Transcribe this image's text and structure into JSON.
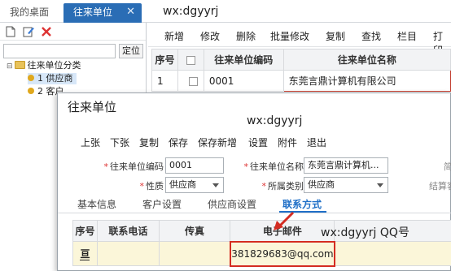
{
  "tabs": {
    "home": "我的桌面",
    "active": "往来单位",
    "close": "✕"
  },
  "watermark": "wx:dgyyrj",
  "left_panel": {
    "search_button": "定位",
    "tree": {
      "root": "往来单位分类",
      "items": [
        "1 供应商",
        "2 客户"
      ]
    }
  },
  "list": {
    "toolbar": [
      "新增",
      "修改",
      "删除",
      "批量修改",
      "复制",
      "查找",
      "栏目",
      "打印"
    ],
    "columns": [
      "序号",
      "",
      "往来单位编码",
      "往来单位名称"
    ],
    "rows": [
      {
        "seq": "1",
        "code": "0001",
        "name": "东莞言鼎计算机有限公司"
      }
    ]
  },
  "dialog": {
    "title": "往来单位",
    "toolbar": [
      "上张",
      "下张",
      "复制",
      "保存",
      "保存新增",
      "设置",
      "附件",
      "退出"
    ],
    "fields": {
      "code_label": "往来单位编码",
      "code_value": "0001",
      "name_label": "往来单位名称",
      "name_value": "东莞言鼎计算机...",
      "nature_label": "性质",
      "nature_value": "供应商",
      "category_label": "所属类别",
      "category_value": "供应商",
      "right_partial_1": "简",
      "right_partial_2": "结算客"
    },
    "subtabs": [
      "基本信息",
      "客户设置",
      "供应商设置",
      "联系方式"
    ],
    "contact_grid": {
      "columns": [
        "序号",
        "联系电话",
        "传真",
        "电子邮件",
        "QQ号"
      ],
      "rows": [
        {
          "seq": "",
          "phone": "",
          "fax": "",
          "email": "381829683@qq.com",
          "qq": ""
        }
      ]
    }
  },
  "accent": "#2a6db5",
  "highlight_color": "#d42c22"
}
